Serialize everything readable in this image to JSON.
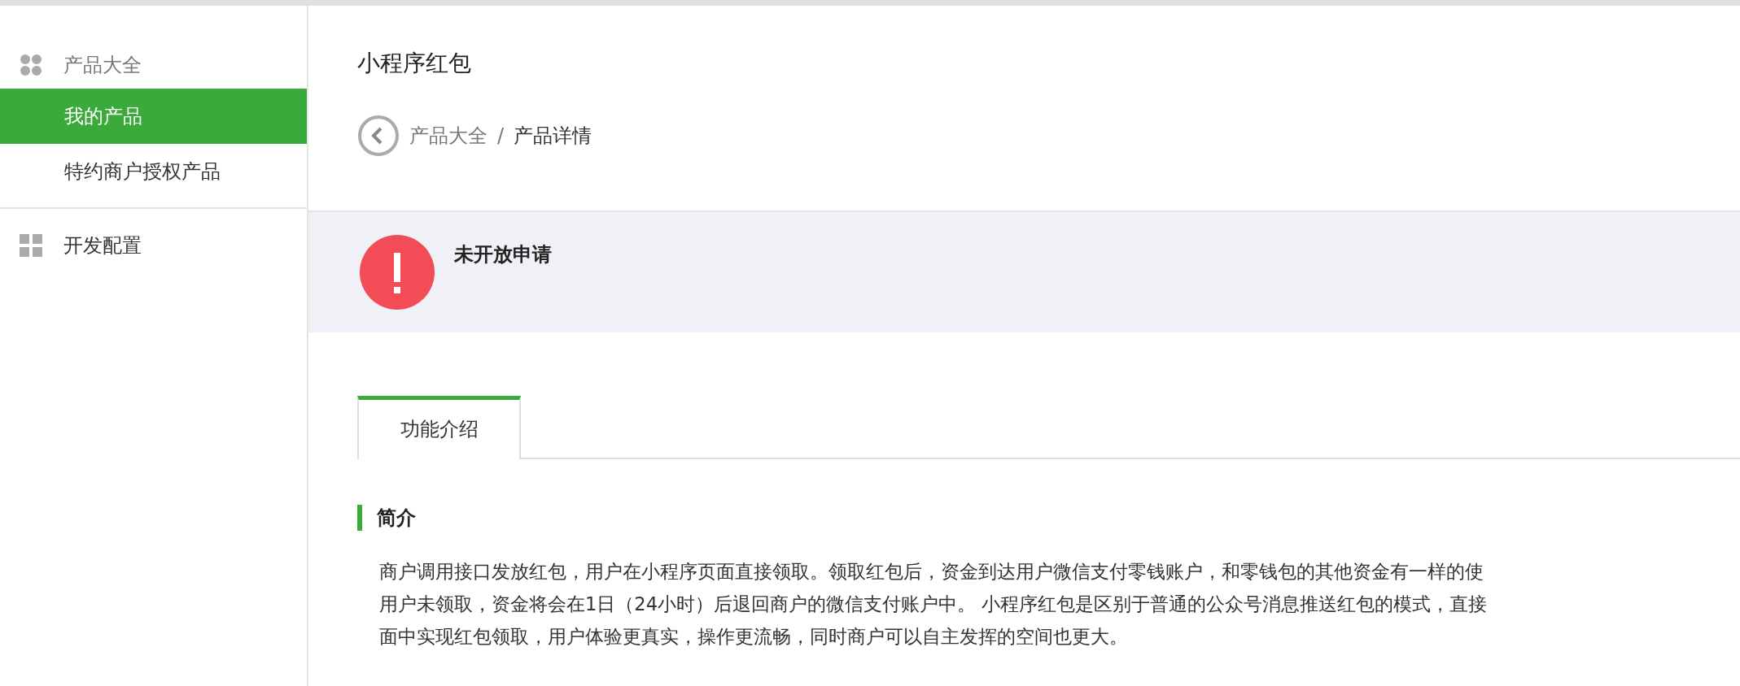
{
  "sidebar": {
    "sections": [
      {
        "label": "产品大全",
        "kind": "dots",
        "expanded": true,
        "items": [
          {
            "label": "我的产品",
            "selected": true
          },
          {
            "label": "特约商户授权产品",
            "selected": false
          }
        ]
      },
      {
        "label": "开发配置",
        "kind": "grid",
        "expanded": false
      }
    ]
  },
  "page": {
    "title": "小程序红包",
    "breadcrumb": [
      {
        "label": "产品大全",
        "current": false
      },
      {
        "label": "产品详情",
        "current": true
      }
    ],
    "separator": "/"
  },
  "alert": {
    "kind": "error",
    "title": "未开放申请"
  },
  "tabs": [
    {
      "label": "功能介绍",
      "selected": true
    }
  ],
  "section": {
    "heading": "简介",
    "lines": [
      "商户调用接口发放红包，用户在小程序页面直接领取。领取红包后，资金到达用户微信支付零钱账户，和零钱包的其他资金有一样的使",
      "用户未领取，资金将会在1日（24小时）后退回商户的微信支付账户中。 小程序红包是区别于普通的公众号消息推送红包的模式，直接",
      "面中实现红包领取，用户体验更真实，操作更流畅，同时商户可以自主发挥的空间也更大。"
    ]
  }
}
